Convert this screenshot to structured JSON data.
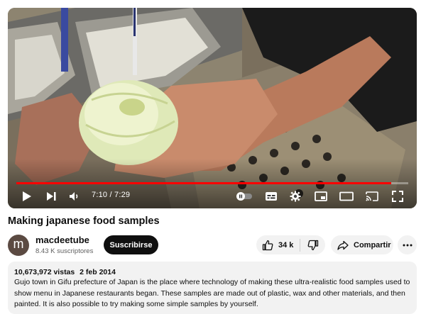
{
  "player": {
    "time_current": "7:10",
    "time_separator": " / ",
    "time_total": "7:29",
    "progress_fraction": 0.957,
    "accent_color": "#ff0000",
    "controls": [
      "play-icon",
      "next-icon",
      "volume-icon",
      "autoplay-toggle",
      "subtitles-icon",
      "settings-icon",
      "miniplayer-icon",
      "theater-icon",
      "cast-icon",
      "fullscreen-icon"
    ]
  },
  "video": {
    "title": "Making japanese food samples"
  },
  "channel": {
    "avatar_letter": "m",
    "name": "macdeetube",
    "subscribers": "8.43 K suscriptores",
    "subscribe_label": "Suscribirse"
  },
  "actions": {
    "like_count": "34 k",
    "share_label": "Compartir",
    "more_icon": "more-horiz-icon"
  },
  "description": {
    "views": "10,673,972 vistas",
    "date": "2 feb 2014",
    "text": "Gujo town in Gifu prefecture of Japan is the place where technology of making these ultra-realistic food samples used to show menu in Japanese restaurants began. These samples are made out of plastic, wax and other materials, and then painted. It is also possible to try making some simple samples by yourself."
  }
}
